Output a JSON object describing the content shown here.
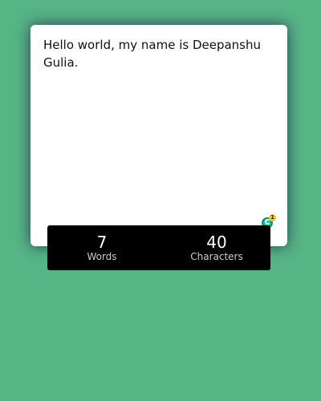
{
  "editor": {
    "text": "Hello world, my name is Deepanshu Gulia."
  },
  "stats": {
    "words": {
      "value": "7",
      "label": "Words"
    },
    "characters": {
      "value": "40",
      "label": "Characters"
    }
  },
  "badge": {
    "count": "1",
    "icon": "grammar-checker-icon"
  },
  "colors": {
    "background": "#57b585",
    "card": "#ffffff",
    "stats_bar": "#000000",
    "badge_green": "#15c39a",
    "badge_dot": "#f2c13a"
  }
}
